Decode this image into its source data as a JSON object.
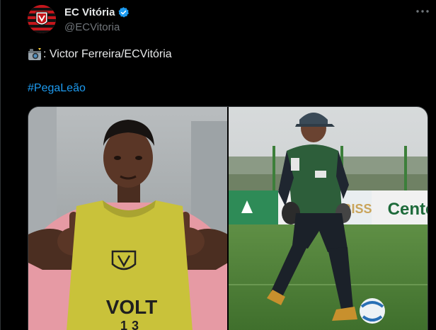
{
  "tweet": {
    "display_name": "EC Vitória",
    "handle": "@ECVitoria",
    "text": ": Victor Ferreira/ECVitória",
    "hashtag": "#PegaLeão",
    "text_emoji_icon": "camera-flash-icon"
  },
  "media": {
    "left_photo": {
      "shirt_text": "VOLT",
      "shirt_number": "13"
    },
    "right_photo": {
      "ad_board_text": "Cente",
      "ad_board_text_2": "RBISS"
    }
  },
  "colors": {
    "background": "#000000",
    "text_primary": "#e7e9ea",
    "text_secondary": "#71767b",
    "link": "#1d9bf0",
    "verified": "#1d9bf0",
    "brand_red": "#c4161c"
  }
}
